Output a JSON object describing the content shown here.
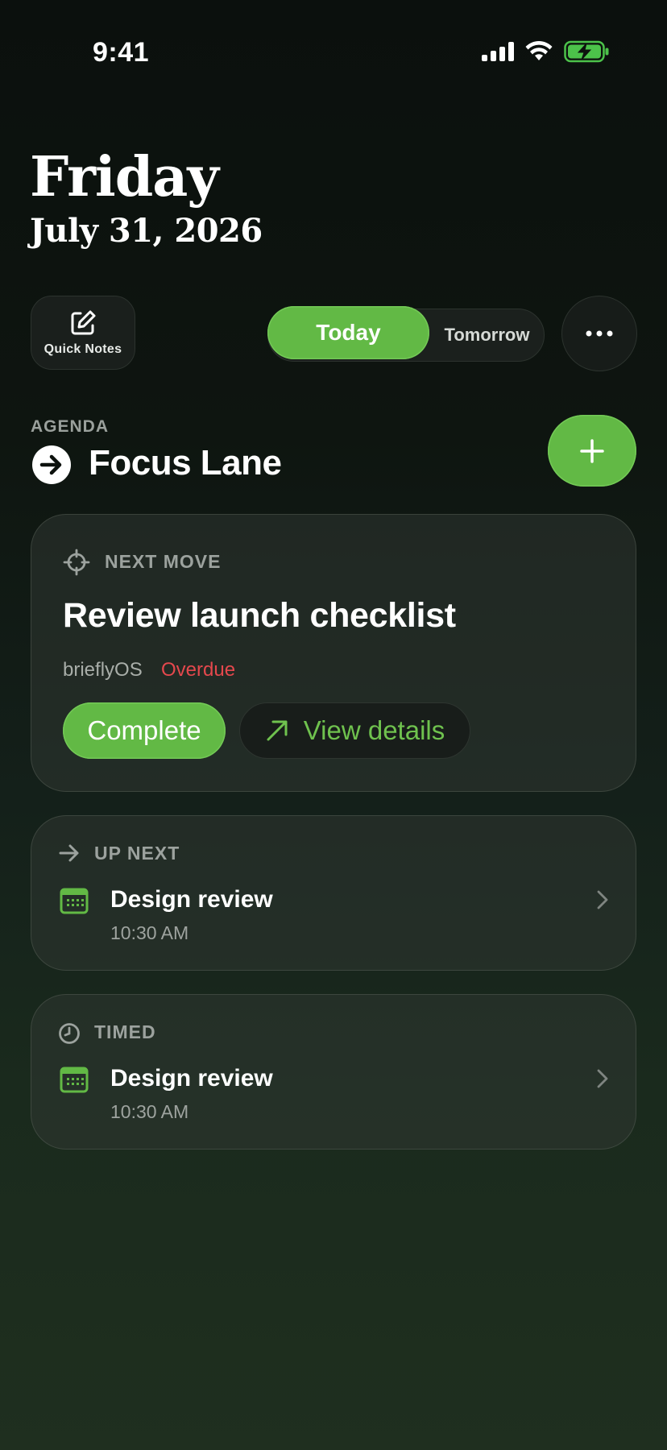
{
  "status_bar": {
    "time": "9:41"
  },
  "header": {
    "day": "Friday",
    "date": "July 31, 2026"
  },
  "controls": {
    "quick_notes_label": "Quick Notes",
    "segments": {
      "today": "Today",
      "tomorrow": "Tomorrow"
    },
    "selected_segment": "Today"
  },
  "agenda": {
    "label": "AGENDA",
    "title": "Focus Lane"
  },
  "next_move": {
    "label": "NEXT MOVE",
    "task_title": "Review launch checklist",
    "project": "brieflyOS",
    "status": "Overdue",
    "complete_label": "Complete",
    "details_label": "View details"
  },
  "up_next": {
    "label": "UP NEXT",
    "event_title": "Design review",
    "event_time": "10:30 AM"
  },
  "timed": {
    "label": "TIMED",
    "event_title": "Design review",
    "event_time": "10:30 AM"
  },
  "colors": {
    "accent": "#62b945",
    "accent_text": "#6fc24e",
    "overdue": "#e5484d",
    "battery": "#4cc24a"
  },
  "icons": [
    "signal-icon",
    "wifi-icon",
    "battery-charging-icon",
    "compose-icon",
    "more-icon",
    "arrow-right-circle-icon",
    "plus-icon",
    "crosshair-icon",
    "arrow-up-right-icon",
    "arrow-right-icon",
    "clock-icon",
    "calendar-icon",
    "chevron-right-icon"
  ]
}
